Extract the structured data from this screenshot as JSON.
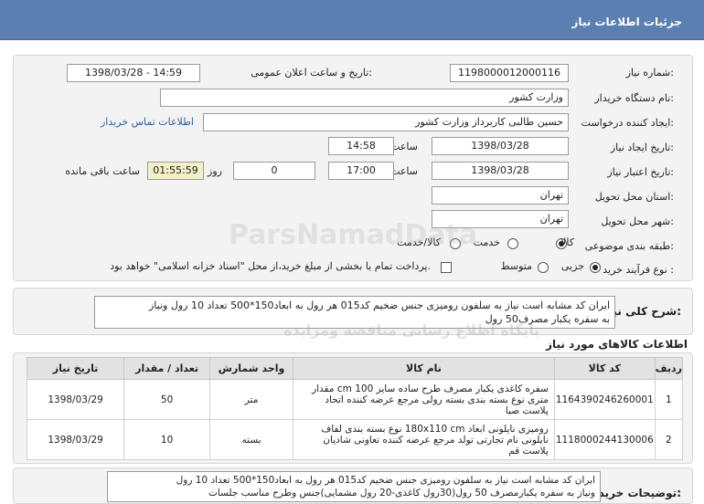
{
  "header": {
    "title": "جزئیات اطلاعات نیاز"
  },
  "form": {
    "need_number_label": "شماره نیاز:",
    "need_number": "1198000012000116",
    "announce_label": "تاریخ و ساعت اعلان عمومی:",
    "announce_value": "1398/03/28 - 14:59",
    "buyer_org_label": "نام دستگاه خریدار:",
    "buyer_org": "وزارت کشور",
    "requester_label": "ایجاد کننده درخواست:",
    "requester": "حسین طالبی کاربرداز وزارت کشور",
    "contact_link": "اطلاعات تماس خریدار",
    "created_label": "تاریخ ایجاد نیاز:",
    "created_date": "1398/03/28",
    "time_label": "ساعت",
    "created_time": "14:58",
    "valid_label": "تاریخ اعتبار نیاز:",
    "valid_date": "1398/03/28",
    "valid_time": "17:00",
    "days_value": "0",
    "days_label": "روز و",
    "remaining_time": "01:55:59",
    "remaining_label": "ساعت باقی مانده",
    "province_label": "استان محل تحویل:",
    "province": "تهران",
    "city_label": "شهر محل تحویل:",
    "city": "تهران",
    "category_label": "طبقه بندی موضوعی:",
    "category_options": [
      "کالا",
      "خدمت",
      "کالا/خدمت"
    ],
    "category_selected": "کالا",
    "process_label": "نوع فرآیند خرید :",
    "process_options": [
      "جزیی",
      "متوسط"
    ],
    "process_selected": "جزیی",
    "payment_note": "پرداخت تمام یا بخشی از مبلغ خرید،از محل \"اسناد خزانه اسلامی\" خواهد بود."
  },
  "summary": {
    "label": "شرح کلی نیاز:",
    "text_line1": "ایران کد مشابه است نیاز به سلفون رومیزی جنس ضخیم کد015 هر رول به ابعاد150*500 تعداد 10 رول ونیاز",
    "text_line2": "به سفره یکبار مصرف50 رول"
  },
  "goods": {
    "section_title": "اطلاعات کالاهای مورد نیاز",
    "columns": [
      "ردیف",
      "کد کالا",
      "نام کالا",
      "واحد شمارش",
      "تعداد / مقدار",
      "تاریخ نیاز"
    ],
    "rows": [
      {
        "idx": "1",
        "code": "1164390246260001",
        "name": "سفره کاغذی یکبار مصرف طرح ساده سایز 100 cm مقدار متری نوع بسته بندی بسته رولی مرجع عرضه کننده اتحاد پلاست صبا",
        "unit": "متر",
        "qty": "50",
        "date": "1398/03/29"
      },
      {
        "idx": "2",
        "code": "1118000244130006",
        "name": "رومیزی نایلونی ابعاد 180x110 cm نوع بسته بندی لفاف نایلونی نام تجارتی تولد مرجع عرضه کننده تعاونی شادیان پلاست قم",
        "unit": "بسته",
        "qty": "10",
        "date": "1398/03/29"
      }
    ]
  },
  "buyer_notes": {
    "label": "توضیحات خریدار:",
    "text_line1": "ایران کد مشابه است نیاز به سلفون رومیزی جنس ضخیم کد015 هر رول به ابعاد150*500 تعداد 10 رول",
    "text_line2": "ونیاز به سفره یکبارمصرف 50 رول(30رول کاغذی-20 رول مشمایی)جنس وطرح مناسب جلسات"
  },
  "watermark": {
    "text1": "ParsNamadData",
    "text2": "پایگاه اطلاع رسانی مناقصه ومزایده"
  }
}
